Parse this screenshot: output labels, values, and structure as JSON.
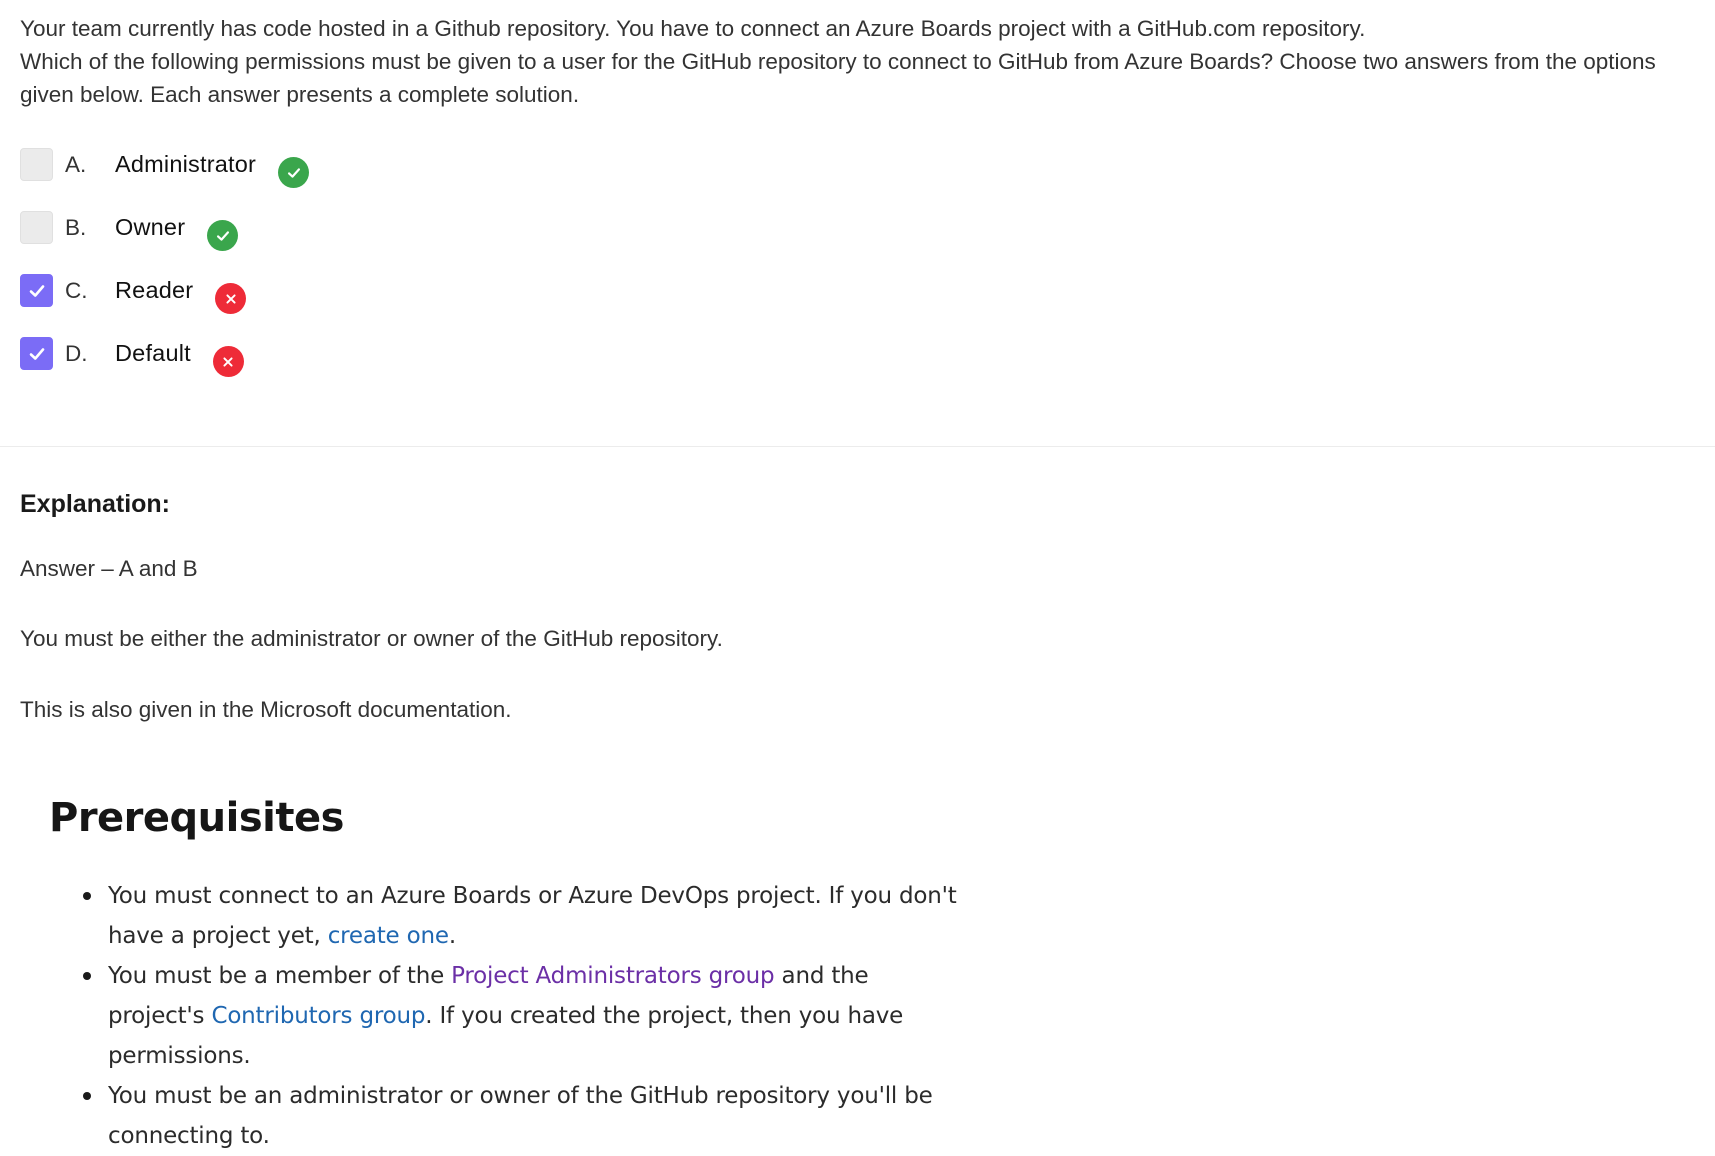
{
  "question": {
    "line1": "Your team currently has code hosted in a Github repository. You have to connect an Azure Boards project with a GitHub.com repository.",
    "line2": "Which of the following permissions must be given to a user for the GitHub repository to connect to GitHub from Azure Boards? Choose two answers from the options given below. Each answer presents a complete solution."
  },
  "options": [
    {
      "letter": "A.",
      "text": "Administrator",
      "checked": false,
      "status": "correct",
      "status_icon": "check-circle-icon"
    },
    {
      "letter": "B.",
      "text": "Owner",
      "checked": false,
      "status": "correct",
      "status_icon": "check-circle-icon"
    },
    {
      "letter": "C.",
      "text": "Reader",
      "checked": true,
      "status": "wrong",
      "status_icon": "x-circle-icon"
    },
    {
      "letter": "D.",
      "text": "Default",
      "checked": true,
      "status": "wrong",
      "status_icon": "x-circle-icon"
    }
  ],
  "explanation": {
    "title": "Explanation:",
    "answer": "Answer – A and B",
    "detail": "You must be either the administrator or owner of the GitHub repository.",
    "source_note": "This is also given in the Microsoft documentation."
  },
  "prerequisites": {
    "title": "Prerequisites",
    "item1": {
      "before": "You must connect to an Azure Boards or Azure DevOps project. If you don't have a project yet, ",
      "link": "create one",
      "after": "."
    },
    "item2": {
      "before": "You must be a member of the ",
      "link1": "Project Administrators group",
      "middle": " and the project's ",
      "link2": "Contributors group",
      "after": ". If you created the project, then you have permissions."
    },
    "item3": {
      "text": "You must be an administrator or owner of the GitHub repository you'll be connecting to."
    }
  },
  "colors": {
    "checkbox_checked": "#7b6cf6",
    "checkbox_unchecked": "#ebebeb",
    "correct": "#3aa64c",
    "wrong": "#ee2b38",
    "link_blue": "#1f67b1",
    "link_purple": "#6b2fa6"
  }
}
